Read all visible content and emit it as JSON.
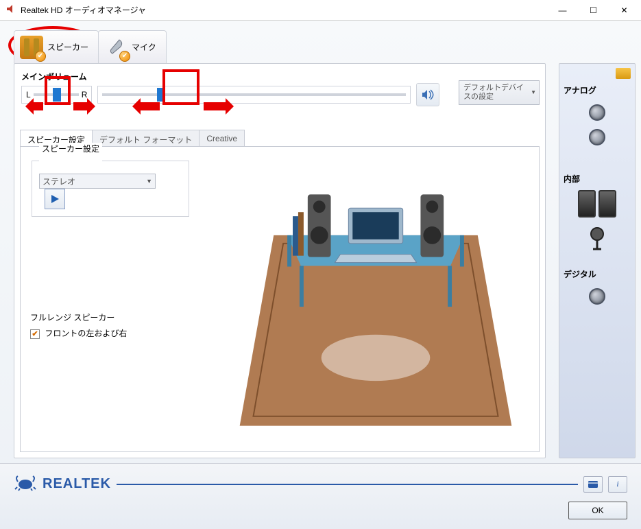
{
  "window": {
    "title": "Realtek HD オーディオマネージャ",
    "minimize": "—",
    "maximize": "☐",
    "close": "✕"
  },
  "device_tabs": {
    "speaker": "スピーカー",
    "mic": "マイク"
  },
  "main_volume": {
    "label": "メインボリューム",
    "L": "L",
    "R": "R",
    "default_device_label": "デフォルトデバイスの設定"
  },
  "sub_tabs": {
    "speaker_cfg": "スピーカー設定",
    "default_format": "デフォルト フォーマット",
    "creative": "Creative"
  },
  "speaker_cfg": {
    "group_label": "スピーカー設定",
    "mode": "ステレオ"
  },
  "fullrange": {
    "group_label": "フルレンジ スピーカー",
    "front_lr": "フロントの左および右"
  },
  "side": {
    "analog": "アナログ",
    "internal": "内部",
    "digital": "デジタル"
  },
  "footer": {
    "brand": "REALTEK",
    "ok": "OK",
    "info": "i"
  }
}
